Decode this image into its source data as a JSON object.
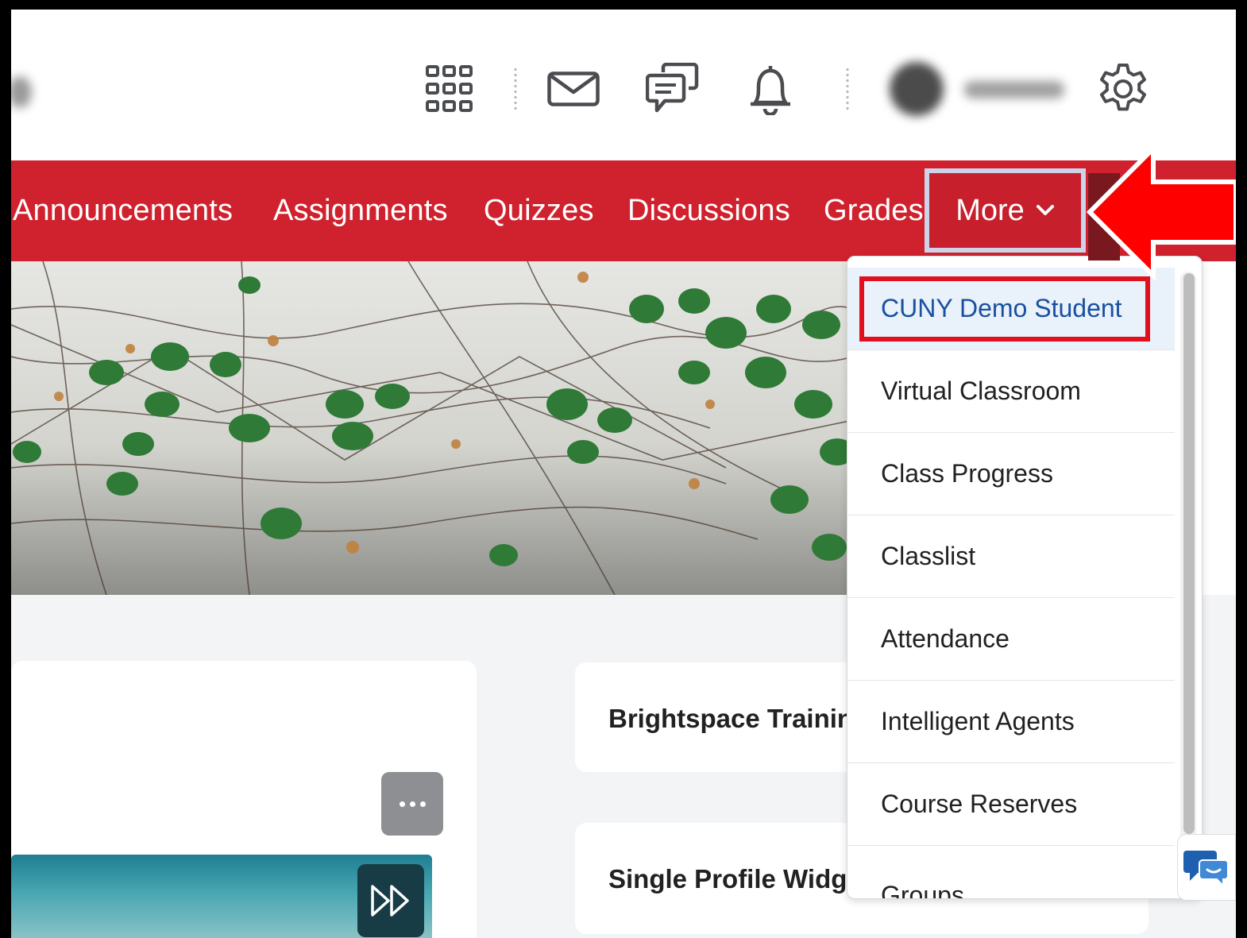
{
  "header": {
    "icons": [
      "grid-icon",
      "mail-icon",
      "chat-icon",
      "bell-icon",
      "gear-icon"
    ]
  },
  "navbar": {
    "items": [
      {
        "label": "Announcements"
      },
      {
        "label": "Assignments"
      },
      {
        "label": "Quizzes"
      },
      {
        "label": "Discussions"
      },
      {
        "label": "Grades"
      }
    ],
    "more_label": "More",
    "color": "#d0222e"
  },
  "dropdown": {
    "items": [
      {
        "label": "CUNY Demo Student"
      },
      {
        "label": "Virtual Classroom"
      },
      {
        "label": "Class Progress"
      },
      {
        "label": "Classlist"
      },
      {
        "label": "Attendance"
      },
      {
        "label": "Intelligent Agents"
      },
      {
        "label": "Course Reserves"
      },
      {
        "label": "Groups"
      }
    ],
    "highlight_color": "#e0101e",
    "selected_text_color": "#19509f"
  },
  "cards": {
    "right": [
      {
        "title": "Brightspace Training"
      },
      {
        "title": "Single Profile Widget"
      }
    ]
  },
  "annotation": {
    "arrow_color": "#ff0000"
  }
}
